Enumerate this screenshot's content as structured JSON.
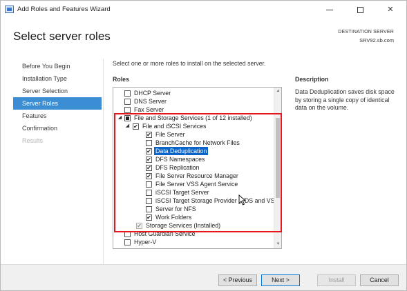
{
  "window": {
    "title": "Add Roles and Features Wizard",
    "controls": {
      "minimize": "",
      "maximize": "",
      "close": "✕"
    }
  },
  "header": {
    "page_title": "Select server roles",
    "destination_label": "DESTINATION SERVER",
    "destination_server": "SRV92.sb.com"
  },
  "nav": {
    "items": [
      {
        "label": "Before You Begin",
        "state": "normal"
      },
      {
        "label": "Installation Type",
        "state": "normal"
      },
      {
        "label": "Server Selection",
        "state": "normal"
      },
      {
        "label": "Server Roles",
        "state": "active"
      },
      {
        "label": "Features",
        "state": "normal"
      },
      {
        "label": "Confirmation",
        "state": "normal"
      },
      {
        "label": "Results",
        "state": "disabled"
      }
    ]
  },
  "content": {
    "instruction": "Select one or more roles to install on the selected server.",
    "roles_heading": "Roles",
    "description_heading": "Description",
    "description_text": "Data Deduplication saves disk space by storing a single copy of identical data on the volume."
  },
  "roles": [
    {
      "label": "DHCP Server",
      "checked": false
    },
    {
      "label": "DNS Server",
      "checked": false
    },
    {
      "label": "Fax Server",
      "checked": false
    },
    {
      "label": "File and Storage Services (1 of 12 installed)",
      "checked": "partial",
      "expander": "◢"
    },
    {
      "label": "File and iSCSI Services",
      "checked": true,
      "expander": "◢"
    },
    {
      "label": "File Server",
      "checked": true
    },
    {
      "label": "BranchCache for Network Files",
      "checked": false
    },
    {
      "label": "Data Deduplication",
      "checked": true,
      "selected": true
    },
    {
      "label": "DFS Namespaces",
      "checked": true
    },
    {
      "label": "DFS Replication",
      "checked": true
    },
    {
      "label": "File Server Resource Manager",
      "checked": true
    },
    {
      "label": "File Server VSS Agent Service",
      "checked": false
    },
    {
      "label": "iSCSI Target Server",
      "checked": false
    },
    {
      "label": "iSCSI Target Storage Provider (VDS and VSS",
      "checked": false
    },
    {
      "label": "Server for NFS",
      "checked": false
    },
    {
      "label": "Work Folders",
      "checked": true
    },
    {
      "label": "Storage Services (Installed)",
      "checked": "disabled"
    },
    {
      "label": "Host Guardian Service",
      "checked": false
    },
    {
      "label": "Hyper-V",
      "checked": false
    }
  ],
  "glyphs": {
    "check": "✔",
    "scroll_up": "▲",
    "scroll_down": "▼"
  },
  "buttons": {
    "previous": "< Previous",
    "next": "Next >",
    "install": "Install",
    "cancel": "Cancel"
  },
  "colors": {
    "accent": "#3c8ed4",
    "selection": "#0a64c8",
    "annotation_box": "#e8161c"
  }
}
